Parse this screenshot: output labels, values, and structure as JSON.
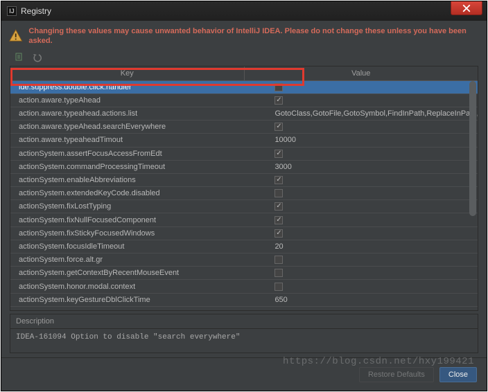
{
  "window": {
    "title": "Registry"
  },
  "warning": {
    "text": "Changing these values may cause unwanted behavior of IntelliJ IDEA. Please do not change these unless you have been asked."
  },
  "headers": {
    "key": "Key",
    "value": "Value"
  },
  "rows": [
    {
      "key": "ide.suppress.double.click.handler",
      "value_type": "check",
      "checked": false,
      "selected": true
    },
    {
      "key": "action.aware.typeAhead",
      "value_type": "check",
      "checked": true
    },
    {
      "key": "action.aware.typeahead.actions.list",
      "value_type": "text",
      "value": "GotoClass,GotoFile,GotoSymbol,FindInPath,ReplaceInPath,FileStru..."
    },
    {
      "key": "action.aware.typeAhead.searchEverywhere",
      "value_type": "check",
      "checked": true
    },
    {
      "key": "action.aware.typeaheadTimout",
      "value_type": "text",
      "value": "10000"
    },
    {
      "key": "actionSystem.assertFocusAccessFromEdt",
      "value_type": "check",
      "checked": true
    },
    {
      "key": "actionSystem.commandProcessingTimeout",
      "value_type": "text",
      "value": "3000"
    },
    {
      "key": "actionSystem.enableAbbreviations",
      "value_type": "check",
      "checked": true
    },
    {
      "key": "actionSystem.extendedKeyCode.disabled",
      "value_type": "check",
      "checked": false
    },
    {
      "key": "actionSystem.fixLostTyping",
      "value_type": "check",
      "checked": true
    },
    {
      "key": "actionSystem.fixNullFocusedComponent",
      "value_type": "check",
      "checked": true
    },
    {
      "key": "actionSystem.fixStickyFocusedWindows",
      "value_type": "check",
      "checked": true
    },
    {
      "key": "actionSystem.focusIdleTimeout",
      "value_type": "text",
      "value": "20"
    },
    {
      "key": "actionSystem.force.alt.gr",
      "value_type": "check",
      "checked": false
    },
    {
      "key": "actionSystem.getContextByRecentMouseEvent",
      "value_type": "check",
      "checked": false
    },
    {
      "key": "actionSystem.honor.modal.context",
      "value_type": "check",
      "checked": false
    },
    {
      "key": "actionSystem.keyGestureDblClickTime",
      "value_type": "text",
      "value": "650"
    }
  ],
  "description": {
    "label": "Description",
    "text": "IDEA-161094 Option to disable \"search everywhere\""
  },
  "buttons": {
    "restore": "Restore Defaults",
    "close": "Close"
  },
  "watermark": "https://blog.csdn.net/hxy199421"
}
